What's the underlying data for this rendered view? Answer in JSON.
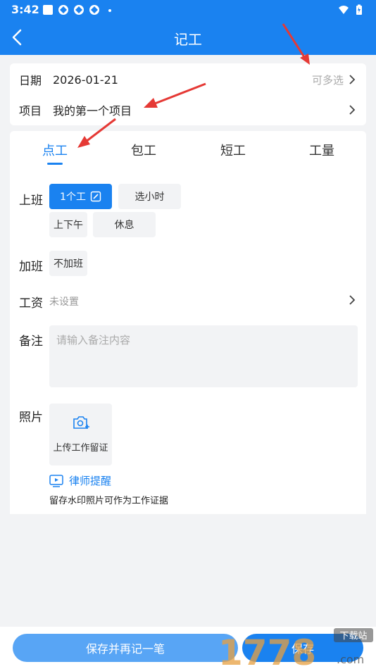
{
  "status": {
    "time": "3:42"
  },
  "nav": {
    "title": "记工"
  },
  "top_card": {
    "date_label": "日期",
    "date_value": "2026-01-21",
    "date_hint": "可多选",
    "project_label": "项目",
    "project_value": "我的第一个项目"
  },
  "tabs": [
    {
      "label": "点工"
    },
    {
      "label": "包工"
    },
    {
      "label": "短工"
    },
    {
      "label": "工量"
    }
  ],
  "form": {
    "shift_label": "上班",
    "shift_options": [
      "1个工",
      "选小时",
      "上下午",
      "休息"
    ],
    "overtime_label": "加班",
    "overtime_value": "不加班",
    "wage_label": "工资",
    "wage_value": "未设置",
    "note_label": "备注",
    "note_placeholder": "请输入备注内容",
    "photo_label": "照片",
    "upload_label": "上传工作留证",
    "lawyer_link": "律师提醒",
    "lawyer_sub": "留存水印照片可作为工作证据"
  },
  "bottom": {
    "save_again_label": "保存并再记一笔",
    "save_label": "保存"
  },
  "watermark": {
    "text": "1778",
    "tag": "下载站",
    "suffix": ".com"
  },
  "colors": {
    "primary": "#1a82f0",
    "bg": "#f2f3f5",
    "arrow": "#e53935"
  }
}
